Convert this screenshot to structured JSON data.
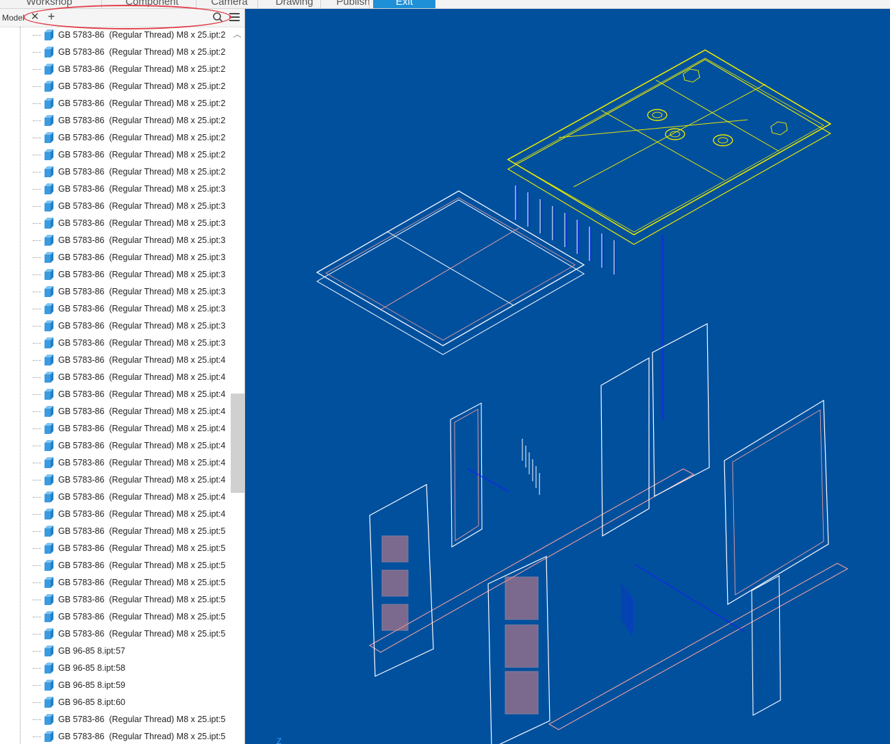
{
  "ribbon": {
    "tabs": [
      {
        "label": "Workshop"
      },
      {
        "label": "Component"
      },
      {
        "label": "Camera"
      },
      {
        "label": "Drawing"
      },
      {
        "label": "Publish"
      },
      {
        "label": "Exit",
        "active": true
      }
    ]
  },
  "browser": {
    "title": "Model",
    "close_icon": "close-icon",
    "add_icon": "plus-icon",
    "search_icon": "search-icon",
    "menu_icon": "hamburger-menu-icon",
    "items": [
      "GB 5783-86  (Regular Thread) M8 x 25.ipt:2",
      "GB 5783-86  (Regular Thread) M8 x 25.ipt:2",
      "GB 5783-86  (Regular Thread) M8 x 25.ipt:2",
      "GB 5783-86  (Regular Thread) M8 x 25.ipt:2",
      "GB 5783-86  (Regular Thread) M8 x 25.ipt:2",
      "GB 5783-86  (Regular Thread) M8 x 25.ipt:2",
      "GB 5783-86  (Regular Thread) M8 x 25.ipt:2",
      "GB 5783-86  (Regular Thread) M8 x 25.ipt:2",
      "GB 5783-86  (Regular Thread) M8 x 25.ipt:2",
      "GB 5783-86  (Regular Thread) M8 x 25.ipt:3",
      "GB 5783-86  (Regular Thread) M8 x 25.ipt:3",
      "GB 5783-86  (Regular Thread) M8 x 25.ipt:3",
      "GB 5783-86  (Regular Thread) M8 x 25.ipt:3",
      "GB 5783-86  (Regular Thread) M8 x 25.ipt:3",
      "GB 5783-86  (Regular Thread) M8 x 25.ipt:3",
      "GB 5783-86  (Regular Thread) M8 x 25.ipt:3",
      "GB 5783-86  (Regular Thread) M8 x 25.ipt:3",
      "GB 5783-86  (Regular Thread) M8 x 25.ipt:3",
      "GB 5783-86  (Regular Thread) M8 x 25.ipt:3",
      "GB 5783-86  (Regular Thread) M8 x 25.ipt:4",
      "GB 5783-86  (Regular Thread) M8 x 25.ipt:4",
      "GB 5783-86  (Regular Thread) M8 x 25.ipt:4",
      "GB 5783-86  (Regular Thread) M8 x 25.ipt:4",
      "GB 5783-86  (Regular Thread) M8 x 25.ipt:4",
      "GB 5783-86  (Regular Thread) M8 x 25.ipt:4",
      "GB 5783-86  (Regular Thread) M8 x 25.ipt:4",
      "GB 5783-86  (Regular Thread) M8 x 25.ipt:4",
      "GB 5783-86  (Regular Thread) M8 x 25.ipt:4",
      "GB 5783-86  (Regular Thread) M8 x 25.ipt:4",
      "GB 5783-86  (Regular Thread) M8 x 25.ipt:5",
      "GB 5783-86  (Regular Thread) M8 x 25.ipt:5",
      "GB 5783-86  (Regular Thread) M8 x 25.ipt:5",
      "GB 5783-86  (Regular Thread) M8 x 25.ipt:5",
      "GB 5783-86  (Regular Thread) M8 x 25.ipt:5",
      "GB 5783-86  (Regular Thread) M8 x 25.ipt:5",
      "GB 5783-86  (Regular Thread) M8 x 25.ipt:5",
      "GB 96-85 8.ipt:57",
      "GB 96-85 8.ipt:58",
      "GB 96-85 8.ipt:59",
      "GB 96-85 8.ipt:60",
      "GB 5783-86  (Regular Thread) M8 x 25.ipt:5",
      "GB 5783-86  (Regular Thread) M8 x 25.ipt:5"
    ],
    "item_icon": "part-cube-icon",
    "scroll_position": 0.5
  },
  "viewport": {
    "background": "#00509e",
    "selected_color": "#e8e800",
    "edge_color": "#ffffff",
    "accent_edge_color": "#f0a0a0",
    "axis_label": "Z"
  }
}
